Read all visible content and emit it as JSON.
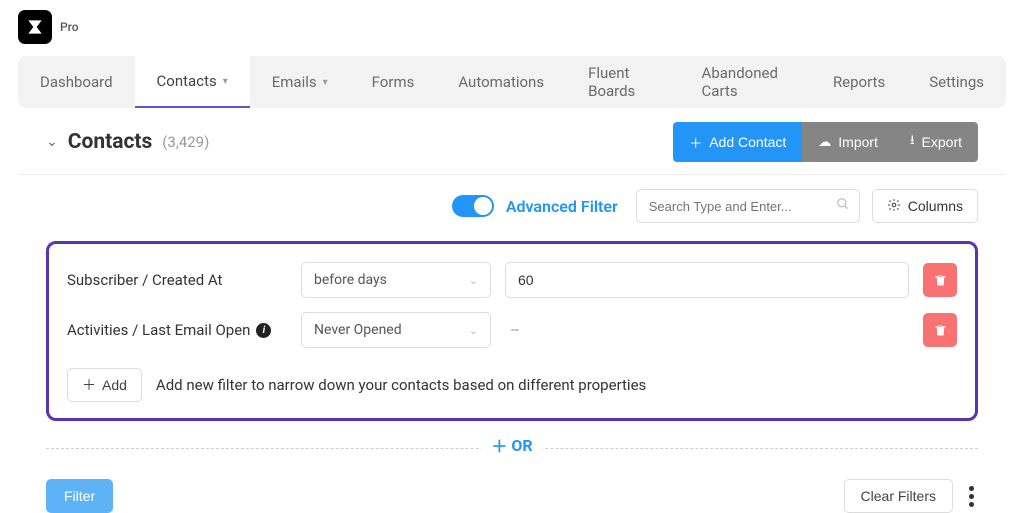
{
  "plan": "Pro",
  "nav": {
    "items": [
      {
        "label": "Dashboard",
        "dropdown": false
      },
      {
        "label": "Contacts",
        "dropdown": true,
        "active": true
      },
      {
        "label": "Emails",
        "dropdown": true
      },
      {
        "label": "Forms",
        "dropdown": false
      },
      {
        "label": "Automations",
        "dropdown": false
      },
      {
        "label": "Fluent Boards",
        "dropdown": false
      },
      {
        "label": "Abandoned Carts",
        "dropdown": false
      },
      {
        "label": "Reports",
        "dropdown": false
      },
      {
        "label": "Settings",
        "dropdown": false
      }
    ]
  },
  "page": {
    "title": "Contacts",
    "count": "(3,429)"
  },
  "actions": {
    "add_contact": "Add Contact",
    "import": "Import",
    "export": "Export"
  },
  "advanced_filter": {
    "label": "Advanced Filter",
    "enabled": true
  },
  "search": {
    "placeholder": "Search Type and Enter..."
  },
  "columns_btn": "Columns",
  "filters": {
    "rows": [
      {
        "label": "Subscriber / Created At",
        "operator": "before days",
        "value": "60",
        "info": false
      },
      {
        "label": "Activities / Last Email Open",
        "operator": "Never Opened",
        "value": "--",
        "info": true,
        "static": true
      }
    ],
    "add_label": "Add",
    "add_hint": "Add new filter to narrow down your contacts based on different properties"
  },
  "or_label": "OR",
  "footer": {
    "apply": "Filter",
    "clear": "Clear Filters"
  }
}
